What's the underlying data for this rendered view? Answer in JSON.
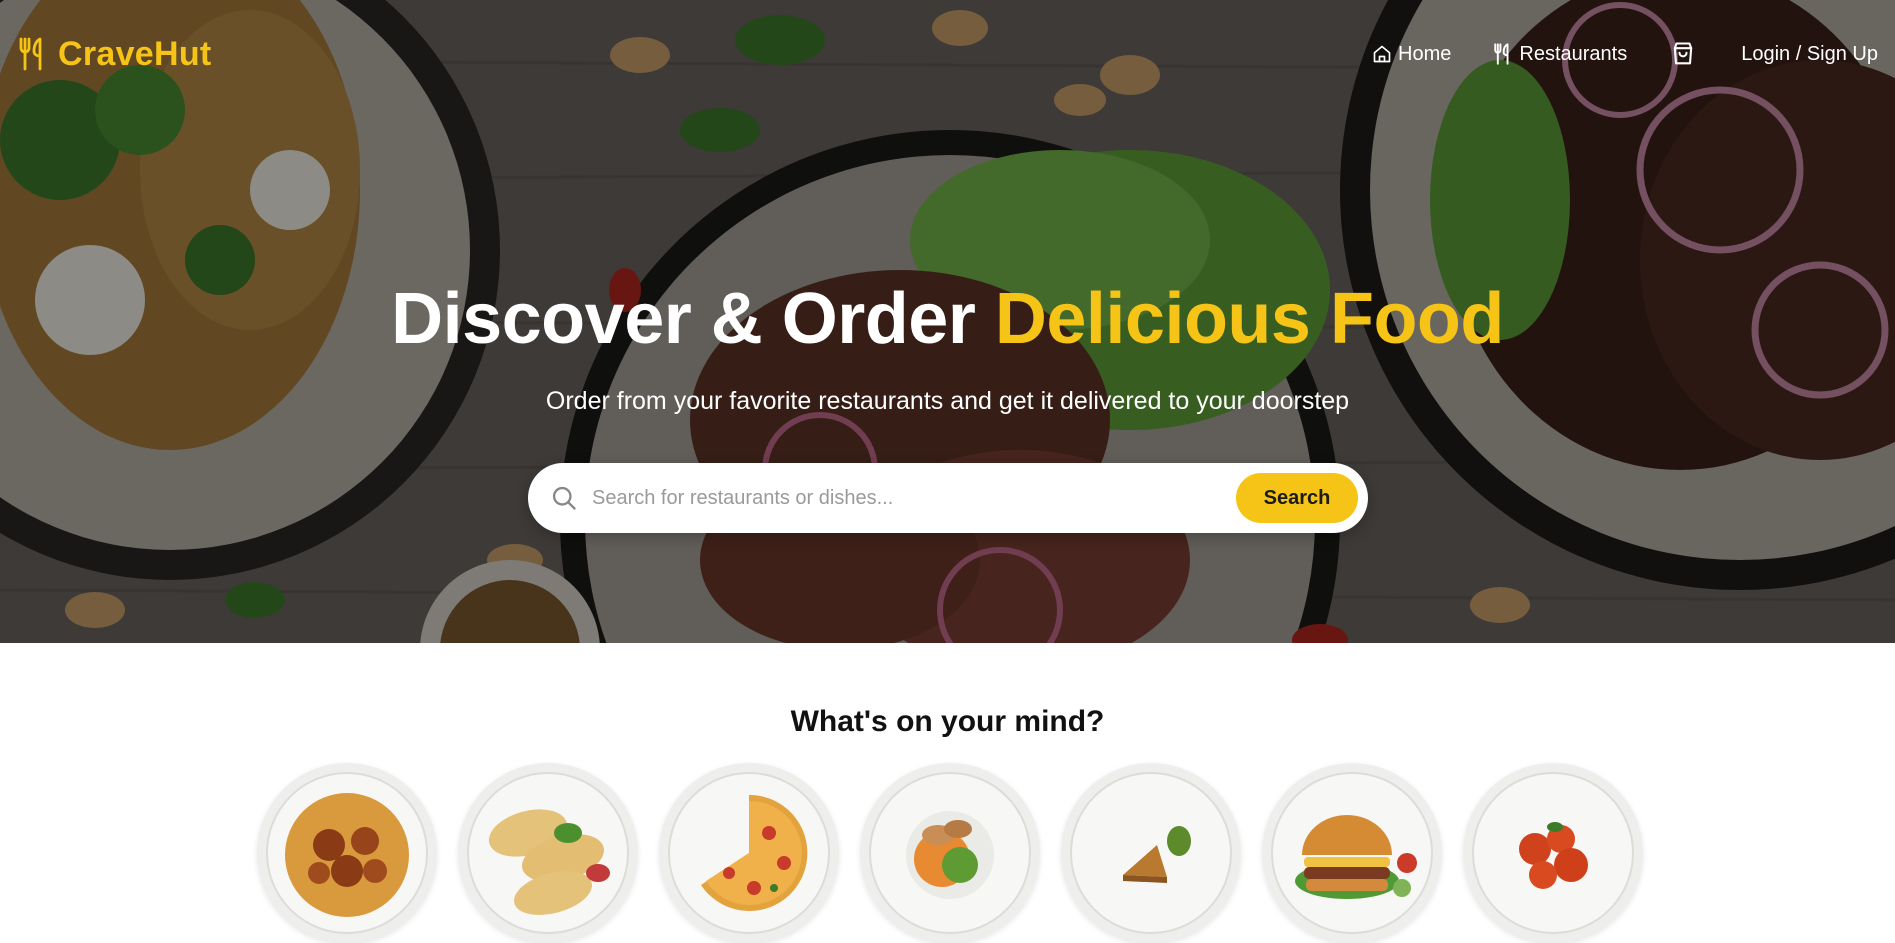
{
  "brand": {
    "name": "CraveHut",
    "logo_icon": "fork-knife-icon",
    "accent_color": "#f6c416"
  },
  "nav": {
    "home_label": "Home",
    "home_icon": "home-icon",
    "restaurants_label": "Restaurants",
    "restaurants_icon": "fork-knife-icon",
    "cart_icon": "shopping-bag-icon",
    "login_label": "Login / Sign Up"
  },
  "hero": {
    "title_main": "Discover & Order",
    "title_accent": "Delicious Food",
    "subtitle": "Order from your favorite restaurants and get it delivered to your doorstep"
  },
  "search": {
    "placeholder": "Search for restaurants or dishes...",
    "value": "",
    "button_label": "Search",
    "icon": "search-icon"
  },
  "categories": {
    "heading": "What's on your mind?",
    "items": [
      {
        "image": "biryani"
      },
      {
        "image": "wraps"
      },
      {
        "image": "pizza"
      },
      {
        "image": "salad"
      },
      {
        "image": "dessert"
      },
      {
        "image": "burger"
      },
      {
        "image": "chicken-wings"
      }
    ]
  }
}
